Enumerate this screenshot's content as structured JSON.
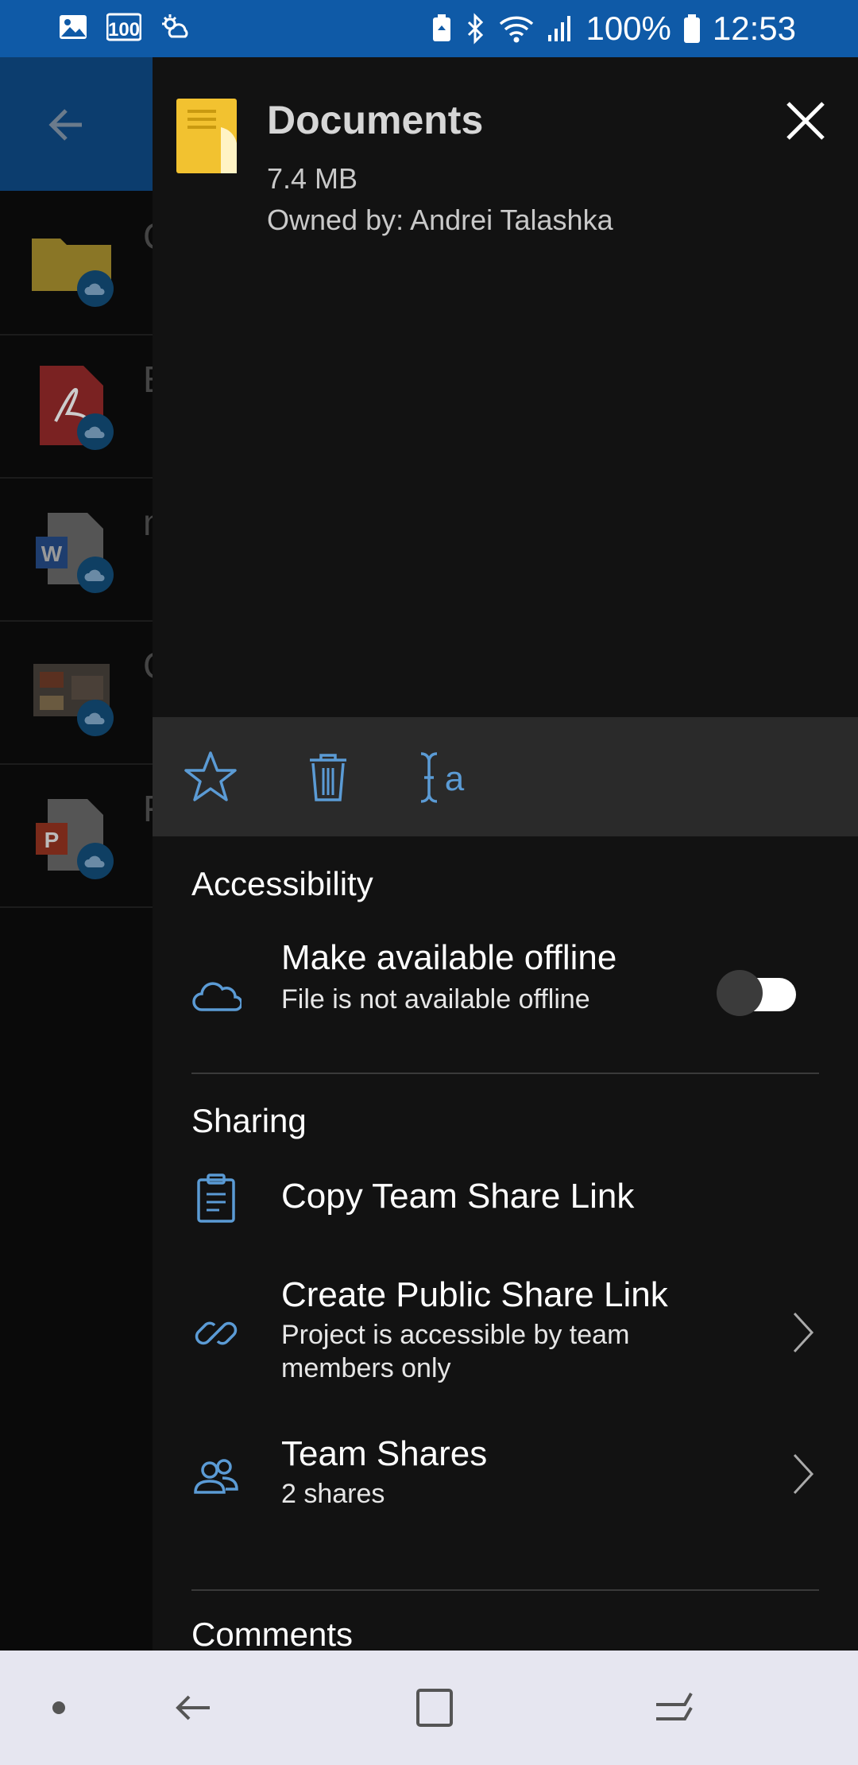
{
  "status_bar": {
    "battery_percent": "100%",
    "time": "12:53",
    "icons": [
      "image-icon",
      "badge-100-icon",
      "sun-cloud-icon",
      "battery-saver-icon",
      "bluetooth-icon",
      "wifi-icon",
      "signal-icon",
      "battery-icon"
    ],
    "badge_text": "100"
  },
  "background_list": {
    "items": [
      {
        "icon": "folder-icon",
        "letter": "C"
      },
      {
        "icon": "pdf-icon",
        "letter": "E"
      },
      {
        "icon": "word-icon",
        "letter": "n"
      },
      {
        "icon": "image-thumbnail-icon",
        "letter": "C"
      },
      {
        "icon": "powerpoint-icon",
        "letter": "F"
      }
    ]
  },
  "details": {
    "title": "Documents",
    "size": "7.4 MB",
    "owner": "Owned by: Andrei Talashka"
  },
  "toolbar": {
    "buttons": [
      "star-icon",
      "trash-icon",
      "rename-icon"
    ]
  },
  "accessibility": {
    "title": "Accessibility",
    "offline": {
      "title": "Make available offline",
      "subtitle": "File is not available offline",
      "enabled": false
    }
  },
  "sharing": {
    "title": "Sharing",
    "copy_link": {
      "title": "Copy Team Share Link"
    },
    "public_link": {
      "title": "Create Public Share Link",
      "subtitle": "Project is accessible by team members only"
    },
    "team_shares": {
      "title": "Team Shares",
      "subtitle": "2 shares"
    }
  },
  "comments": {
    "title": "Comments"
  },
  "colors": {
    "status_bar": "#0f5aa7",
    "accent_icon": "#5b9bd5",
    "panel_bg": "#121212",
    "toolbar_bg": "#2a2a2a"
  }
}
